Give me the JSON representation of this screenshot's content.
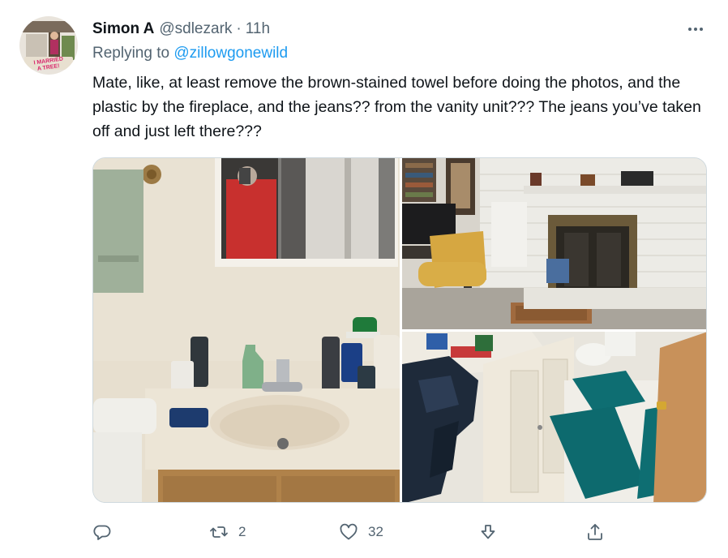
{
  "tweet": {
    "author_name": "Simon A",
    "author_handle": "@sdlezark",
    "separator": "·",
    "time": "11h",
    "replying_label": "Replying to",
    "replying_to": "@zillowgonewild",
    "text": "Mate, like, at least remove the brown-stained towel before doing the photos, and the plastic by the fireplace, and the jeans?? from the vanity unit??? The jeans you’ve taken off and just left there???",
    "avatar_text_line1": "I MARRIED",
    "avatar_text_line2": "A TREE!",
    "more_icon": "more-horizontal-icon"
  },
  "media": {
    "photos": [
      {
        "description_name": "bathroom-vanity-photo"
      },
      {
        "description_name": "living-room-fireplace-photo"
      },
      {
        "description_name": "bathroom-jeans-photo"
      }
    ]
  },
  "actions": {
    "reply_count": "",
    "retweet_count": "2",
    "like_count": "32"
  },
  "colors": {
    "accent": "#1d9bf0",
    "secondary_text": "#536471",
    "primary_text": "#0f1419"
  }
}
